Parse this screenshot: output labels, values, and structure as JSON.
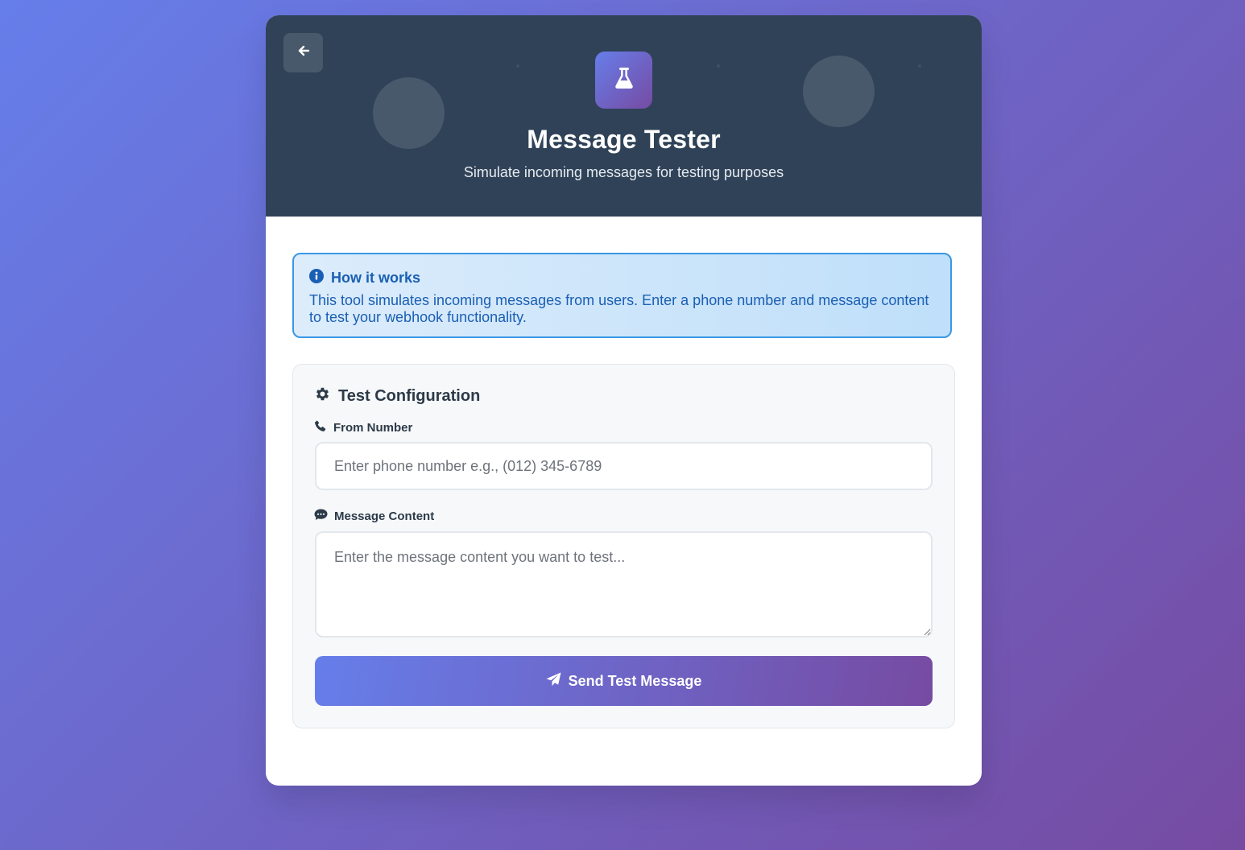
{
  "header": {
    "title": "Message Tester",
    "subtitle": "Simulate incoming messages for testing purposes",
    "back_icon": "arrow-left-icon",
    "logo_icon": "flask-icon",
    "background_color": "#2f4257"
  },
  "info": {
    "icon": "info-circle-icon",
    "title": "How it works",
    "text": "This tool simulates incoming messages from users. Enter a phone number and message content to test your webhook functionality."
  },
  "config": {
    "icon": "gear-icon",
    "title": "Test Configuration",
    "from_number": {
      "icon": "phone-icon",
      "label": "From Number",
      "value": "",
      "placeholder": "Enter phone number e.g., (012) 345-6789"
    },
    "message": {
      "icon": "comment-icon",
      "label": "Message Content",
      "value": "",
      "placeholder": "Enter the message content you want to test..."
    },
    "send": {
      "icon": "paper-plane-icon",
      "label": "Send Test Message"
    }
  },
  "colors": {
    "gradient_start": "#667eea",
    "gradient_end": "#764ba2",
    "info_accent": "#1a5fb4"
  }
}
